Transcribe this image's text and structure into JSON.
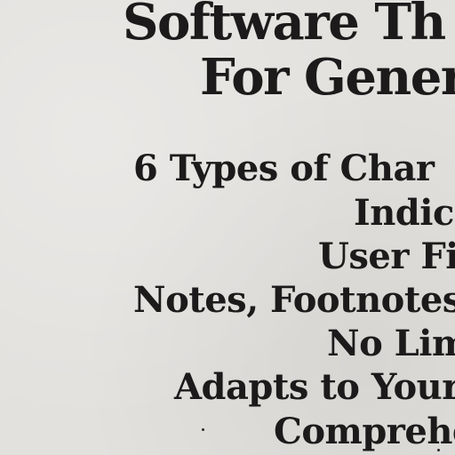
{
  "headline": {
    "line1": "Software Th",
    "line2": "For Gener"
  },
  "features": [
    "6 Types of Char",
    "Indic",
    "User Fi",
    "Notes, Footnotes",
    "No Lim",
    "Adapts to Your",
    "Comprehe"
  ]
}
